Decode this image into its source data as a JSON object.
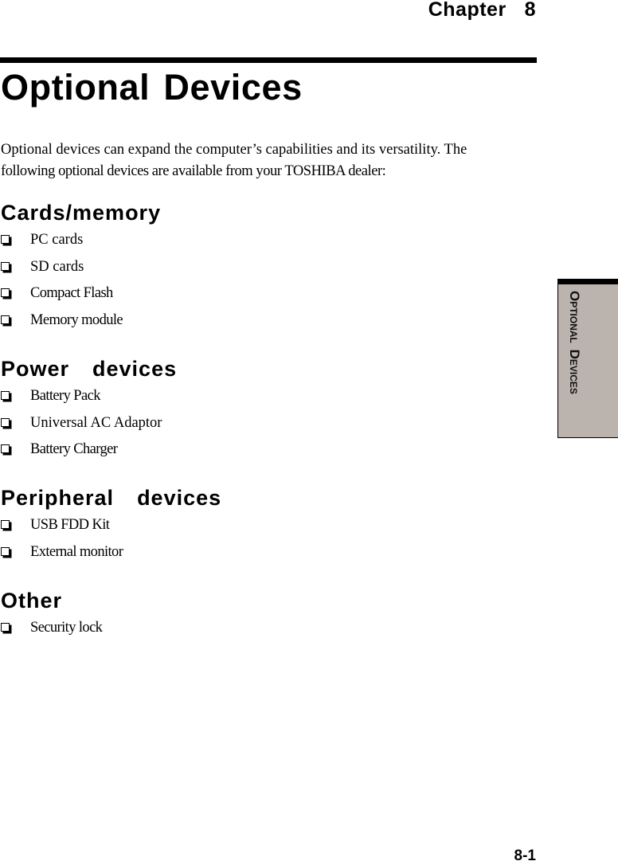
{
  "header": {
    "chapter_label": "Chapter  8"
  },
  "page": {
    "title": "Optional Devices",
    "intro_lines": [
      "Optional devices can expand the computer’s capabilities and its versatility. The",
      "following optional devices are available from your TOSHIBA dealer:"
    ]
  },
  "sections": [
    {
      "heading": "Cards/memory",
      "bullet_icon": "shadowed-checkbox-bullet",
      "items": [
        "PC cards",
        "SD cards",
        "Compact Flash",
        "Memory module"
      ]
    },
    {
      "heading": "Power  devices",
      "bullet_icon": "shadowed-checkbox-bullet",
      "items": [
        "Battery Pack",
        "Universal AC Adaptor",
        "Battery Charger"
      ]
    },
    {
      "heading": "Peripheral  devices",
      "bullet_icon": "shadowed-checkbox-bullet",
      "items": [
        "USB FDD Kit",
        "External monitor"
      ]
    },
    {
      "heading": "Other",
      "bullet_icon": "shadowed-checkbox-bullet",
      "items": [
        "Security lock"
      ]
    }
  ],
  "side_tab": {
    "label": "Optional Devices",
    "background_color": "#bab3ae"
  },
  "footer": {
    "page_number": "8-1"
  }
}
